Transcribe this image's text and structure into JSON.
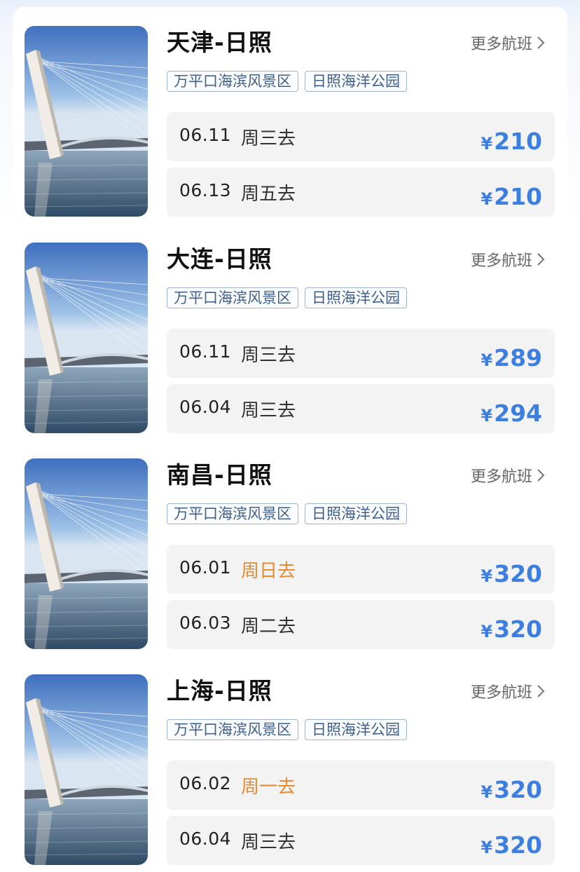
{
  "routes": [
    {
      "title": "天津-日照",
      "more_label": "更多航班",
      "tags": [
        "万平口海滨风景区",
        "日照海洋公园"
      ],
      "flights": [
        {
          "date": "06.11",
          "day": "周三去",
          "currency": "¥",
          "price": "210",
          "highlight": false
        },
        {
          "date": "06.13",
          "day": "周五去",
          "currency": "¥",
          "price": "210",
          "highlight": false
        }
      ]
    },
    {
      "title": "大连-日照",
      "more_label": "更多航班",
      "tags": [
        "万平口海滨风景区",
        "日照海洋公园"
      ],
      "flights": [
        {
          "date": "06.11",
          "day": "周三去",
          "currency": "¥",
          "price": "289",
          "highlight": false
        },
        {
          "date": "06.04",
          "day": "周三去",
          "currency": "¥",
          "price": "294",
          "highlight": false
        }
      ]
    },
    {
      "title": "南昌-日照",
      "more_label": "更多航班",
      "tags": [
        "万平口海滨风景区",
        "日照海洋公园"
      ],
      "flights": [
        {
          "date": "06.01",
          "day": "周日去",
          "currency": "¥",
          "price": "320",
          "highlight": true
        },
        {
          "date": "06.03",
          "day": "周二去",
          "currency": "¥",
          "price": "320",
          "highlight": false
        }
      ]
    },
    {
      "title": "上海-日照",
      "more_label": "更多航班",
      "tags": [
        "万平口海滨风景区",
        "日照海洋公园"
      ],
      "flights": [
        {
          "date": "06.02",
          "day": "周一去",
          "currency": "¥",
          "price": "320",
          "highlight": true
        },
        {
          "date": "06.04",
          "day": "周三去",
          "currency": "¥",
          "price": "320",
          "highlight": false
        }
      ]
    }
  ],
  "colors": {
    "price": "#3d7fe0",
    "weekend": "#e98a2c",
    "tag_border": "#9fb4d0",
    "tag_text": "#3e5f8c"
  },
  "icons": {
    "more": "chevron-right-icon",
    "thumbnail": "bridge-photo"
  }
}
